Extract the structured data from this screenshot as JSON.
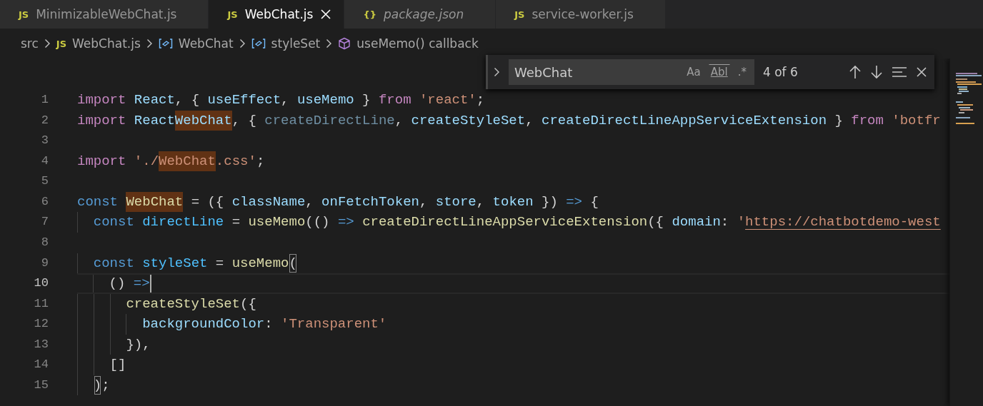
{
  "tabs": [
    {
      "icon": "JS",
      "label": "MinimizableWebChat.js",
      "selected": false,
      "preview": false
    },
    {
      "icon": "JS",
      "label": "WebChat.js",
      "selected": true,
      "preview": false
    },
    {
      "icon": "{}",
      "label": "package.json",
      "selected": false,
      "preview": true
    },
    {
      "icon": "JS",
      "label": "service-worker.js",
      "selected": false,
      "preview": false
    }
  ],
  "breadcrumb": [
    {
      "kind": "folder",
      "label": "src"
    },
    {
      "kind": "js",
      "icon": "JS",
      "label": "WebChat.js"
    },
    {
      "kind": "variable",
      "label": "WebChat"
    },
    {
      "kind": "variable",
      "label": "styleSet"
    },
    {
      "kind": "method",
      "label": "useMemo() callback"
    }
  ],
  "find": {
    "value": "WebChat",
    "options": [
      {
        "label": "Aa",
        "kind": "case",
        "on": false
      },
      {
        "label": "Abl",
        "kind": "word",
        "on": false
      },
      {
        "label": ".*",
        "kind": "regex",
        "on": false
      }
    ],
    "count": "4 of 6"
  },
  "lines": [
    {
      "number": "1",
      "current": false,
      "tokens": [
        {
          "text": "import",
          "kind": "kw"
        },
        {
          "text": " React",
          "kind": "var"
        },
        {
          "text": ", { ",
          "kind": "punc"
        },
        {
          "text": "useEffect",
          "kind": "var"
        },
        {
          "text": ", ",
          "kind": "punc"
        },
        {
          "text": "useMemo",
          "kind": "var"
        },
        {
          "text": " } ",
          "kind": "punc"
        },
        {
          "text": "from",
          "kind": "kw"
        },
        {
          "text": " 'react'",
          "kind": "str"
        },
        {
          "text": ";",
          "kind": "punc"
        }
      ]
    },
    {
      "number": "2",
      "current": false,
      "tokens": [
        {
          "text": "import",
          "kind": "kw"
        },
        {
          "text": " React",
          "kind": "var"
        },
        {
          "text": "WebChat",
          "kind": "var",
          "match": true
        },
        {
          "text": ", { ",
          "kind": "punc"
        },
        {
          "text": "createDirectLine",
          "kind": "dim"
        },
        {
          "text": ", ",
          "kind": "punc"
        },
        {
          "text": "createStyleSet",
          "kind": "var"
        },
        {
          "text": ", ",
          "kind": "punc"
        },
        {
          "text": "createDirectLineAppServiceExtension",
          "kind": "var"
        },
        {
          "text": " } ",
          "kind": "punc"
        },
        {
          "text": "from",
          "kind": "kw"
        },
        {
          "text": " 'botfr",
          "kind": "str"
        }
      ]
    },
    {
      "number": "3",
      "current": false
    },
    {
      "number": "4",
      "current": false,
      "tokens": [
        {
          "text": "import",
          "kind": "kw"
        },
        {
          "text": " './",
          "kind": "str"
        },
        {
          "text": "WebChat",
          "kind": "str",
          "match": true
        },
        {
          "text": ".css'",
          "kind": "str"
        },
        {
          "text": ";",
          "kind": "punc"
        }
      ]
    },
    {
      "number": "5",
      "current": false
    },
    {
      "number": "6",
      "current": false,
      "tokens": [
        {
          "text": "const ",
          "kind": "decl"
        },
        {
          "text": "WebChat",
          "kind": "fn",
          "match": true
        },
        {
          "text": " = ({ ",
          "kind": "punc"
        },
        {
          "text": "className",
          "kind": "var"
        },
        {
          "text": ", ",
          "kind": "punc"
        },
        {
          "text": "onFetchToken",
          "kind": "var"
        },
        {
          "text": ", ",
          "kind": "punc"
        },
        {
          "text": "store",
          "kind": "var"
        },
        {
          "text": ", ",
          "kind": "punc"
        },
        {
          "text": "token",
          "kind": "var"
        },
        {
          "text": " }) ",
          "kind": "punc"
        },
        {
          "text": "=>",
          "kind": "decl"
        },
        {
          "text": " {",
          "kind": "punc"
        }
      ]
    },
    {
      "number": "7",
      "current": false,
      "tokens": [
        {
          "text": "  const ",
          "kind": "decl"
        },
        {
          "text": "directLine",
          "kind": "const"
        },
        {
          "text": " = ",
          "kind": "punc"
        },
        {
          "text": "useMemo",
          "kind": "fn"
        },
        {
          "text": "(() ",
          "kind": "punc"
        },
        {
          "text": "=> ",
          "kind": "decl"
        },
        {
          "text": "createDirectLineAppServiceExtension",
          "kind": "fn"
        },
        {
          "text": "({ ",
          "kind": "punc"
        },
        {
          "text": "domain",
          "kind": "var"
        },
        {
          "text": ": ",
          "kind": "punc"
        },
        {
          "text": "'",
          "kind": "str"
        },
        {
          "text": "https://chatbotdemo-west",
          "kind": "link"
        }
      ]
    },
    {
      "number": "8",
      "current": false
    },
    {
      "number": "9",
      "current": false,
      "tokens": [
        {
          "text": "  const ",
          "kind": "decl"
        },
        {
          "text": "styleSet",
          "kind": "const"
        },
        {
          "text": " = ",
          "kind": "punc"
        },
        {
          "text": "useMemo",
          "kind": "fn"
        },
        {
          "text": "(",
          "kind": "bracket"
        }
      ]
    },
    {
      "number": "10",
      "current": true,
      "tokens": [
        {
          "text": "    () ",
          "kind": "punc"
        },
        {
          "text": "=>",
          "kind": "decl"
        }
      ]
    },
    {
      "number": "11",
      "current": false,
      "tokens": [
        {
          "text": "      createStyleSet",
          "kind": "fn"
        },
        {
          "text": "({",
          "kind": "punc"
        }
      ]
    },
    {
      "number": "12",
      "current": false,
      "tokens": [
        {
          "text": "        backgroundColor",
          "kind": "var"
        },
        {
          "text": ": ",
          "kind": "punc"
        },
        {
          "text": "'Transparent'",
          "kind": "str"
        }
      ]
    },
    {
      "number": "13",
      "current": false,
      "tokens": [
        {
          "text": "      }),",
          "kind": "punc"
        }
      ]
    },
    {
      "number": "14",
      "current": false,
      "tokens": [
        {
          "text": "    []",
          "kind": "punc"
        }
      ]
    },
    {
      "number": "15",
      "current": false,
      "tokens": [
        {
          "text": "  )",
          "kind": "bracket"
        },
        {
          "text": ";",
          "kind": "punc"
        }
      ]
    }
  ]
}
